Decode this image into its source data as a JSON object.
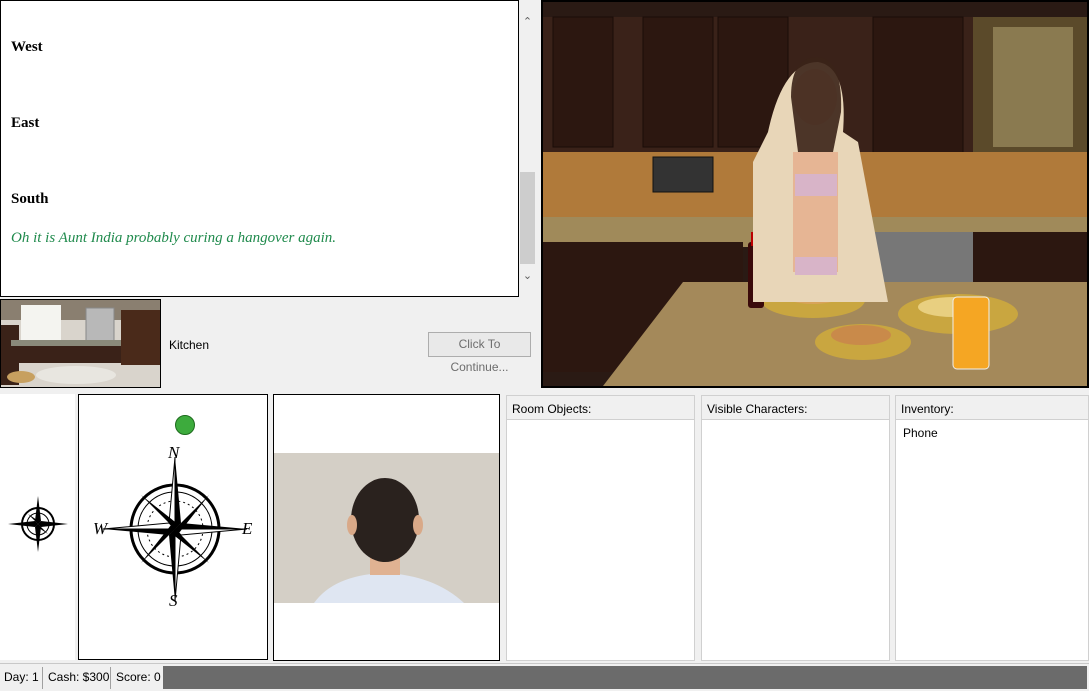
{
  "story": {
    "lines": [
      "West",
      "East",
      "South"
    ],
    "flavor": "Oh it is Aunt India probably curing a hangover again."
  },
  "location": {
    "name": "Kitchen"
  },
  "continue_label": "Click To Continue...",
  "compass": {
    "n": "N",
    "s": "S",
    "e": "E",
    "w": "W"
  },
  "panels": {
    "room_objects": {
      "title": "Room Objects:",
      "items": []
    },
    "characters": {
      "title": "Visible Characters:",
      "items": []
    },
    "inventory": {
      "title": "Inventory:",
      "items": [
        "Phone"
      ]
    }
  },
  "status": {
    "day": "Day: 1",
    "cash": "Cash: $300",
    "score": "Score: 0"
  },
  "colors": {
    "flavor_text": "#1f8a4c",
    "nav_dot": "#3dab3d"
  }
}
